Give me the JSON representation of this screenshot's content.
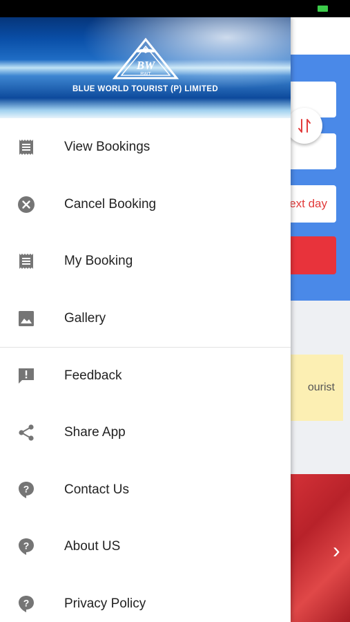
{
  "drawer": {
    "company_name": "BLUE WORLD TOURIST (P) LIMITED",
    "logo_text": "BWT",
    "items": [
      {
        "label": "View Bookings",
        "icon": "receipt-icon"
      },
      {
        "label": "Cancel Booking",
        "icon": "cancel-icon"
      },
      {
        "label": "My Booking",
        "icon": "receipt-icon"
      },
      {
        "label": "Gallery",
        "icon": "image-icon"
      },
      {
        "label": "Feedback",
        "icon": "feedback-icon"
      },
      {
        "label": "Share App",
        "icon": "share-icon"
      },
      {
        "label": "Contact Us",
        "icon": "help-icon"
      },
      {
        "label": "About US",
        "icon": "help-icon"
      },
      {
        "label": "Privacy Policy",
        "icon": "help-icon"
      }
    ]
  },
  "background": {
    "next_day_label": "ext day",
    "notice_fragment": "ourist"
  },
  "colors": {
    "primary_blue": "#4a89e8",
    "accent_red": "#e8333b",
    "notice_yellow": "#fcefb3",
    "icon_gray": "#757575"
  }
}
